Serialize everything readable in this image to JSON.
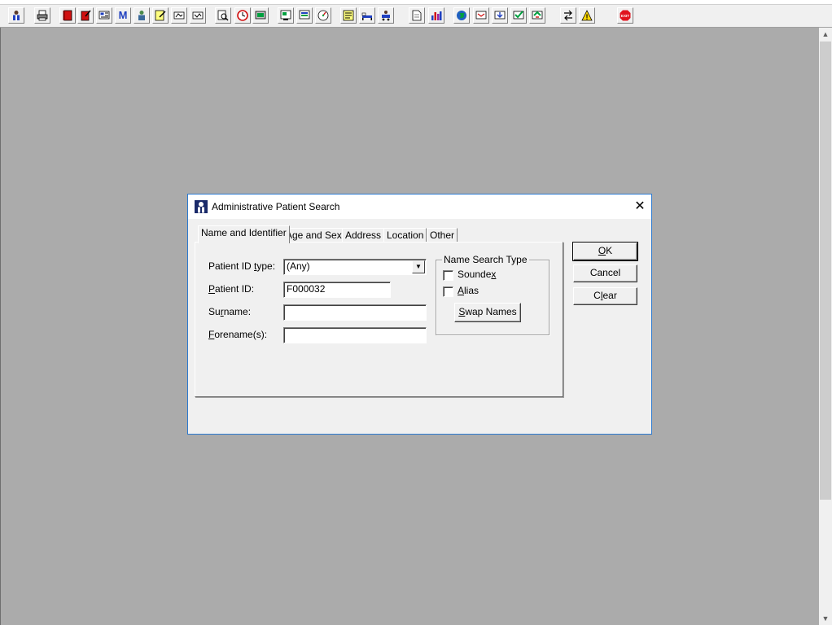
{
  "toolbar": {
    "icons": [
      "patient-icon",
      "printer-icon",
      "book-icon",
      "edit-book-icon",
      "image-list-icon",
      "letter-m-icon",
      "doctor-icon",
      "notes-icon",
      "flag-icon",
      "flag-alt-icon",
      "magnify-doc-icon",
      "clock-icon",
      "monitor-icon",
      "screen-chart-icon",
      "form-icon",
      "gauge-icon",
      "note-pad-icon",
      "bed-icon",
      "transport-icon",
      "document-icon",
      "bar-chart-icon",
      "globe-icon",
      "inbox-icon",
      "download-icon",
      "check-download-icon",
      "refresh-download-icon",
      "swap-icon",
      "warning-icon",
      "exit-icon"
    ],
    "exit_label": "EXIT",
    "warning_mark": "!",
    "m_mark": "M"
  },
  "dialog": {
    "title": "Administrative Patient Search",
    "close_glyph": "✕",
    "tabs": [
      "Name and Identifier",
      "Age and Sex",
      "Address",
      "Location",
      "Other"
    ],
    "active_tab": "Name and Identifier",
    "fields": {
      "patient_id_type": {
        "label_pre": "Patient ID ",
        "label_u": "t",
        "label_post": "ype:",
        "value": "(Any)"
      },
      "patient_id": {
        "label_pre": "",
        "label_u": "P",
        "label_post": "atient ID:",
        "value": "F000032"
      },
      "surname": {
        "label_pre": "Su",
        "label_u": "r",
        "label_post": "name:",
        "value": ""
      },
      "forenames": {
        "label_pre": "",
        "label_u": "F",
        "label_post": "orename(s):",
        "value": ""
      }
    },
    "name_search_type": {
      "legend": "Name Search Type",
      "soundex": {
        "label_pre": "Sounde",
        "label_u": "x",
        "label_post": "",
        "checked": false
      },
      "alias": {
        "label_pre": "",
        "label_u": "A",
        "label_post": "lias",
        "checked": false
      },
      "swap_names": {
        "label_pre": "",
        "label_u": "S",
        "label_post": "wap Names"
      }
    },
    "buttons": {
      "ok": {
        "label_pre": "",
        "label_u": "O",
        "label_post": "K"
      },
      "cancel": "Cancel",
      "clear": {
        "label_pre": "C",
        "label_u": "l",
        "label_post": "ear"
      }
    }
  },
  "colors": {
    "workspace": "#ababab",
    "dialog_bg": "#f0f0f0",
    "dialog_border": "#2b79d0",
    "exit_red": "#e0141e"
  }
}
